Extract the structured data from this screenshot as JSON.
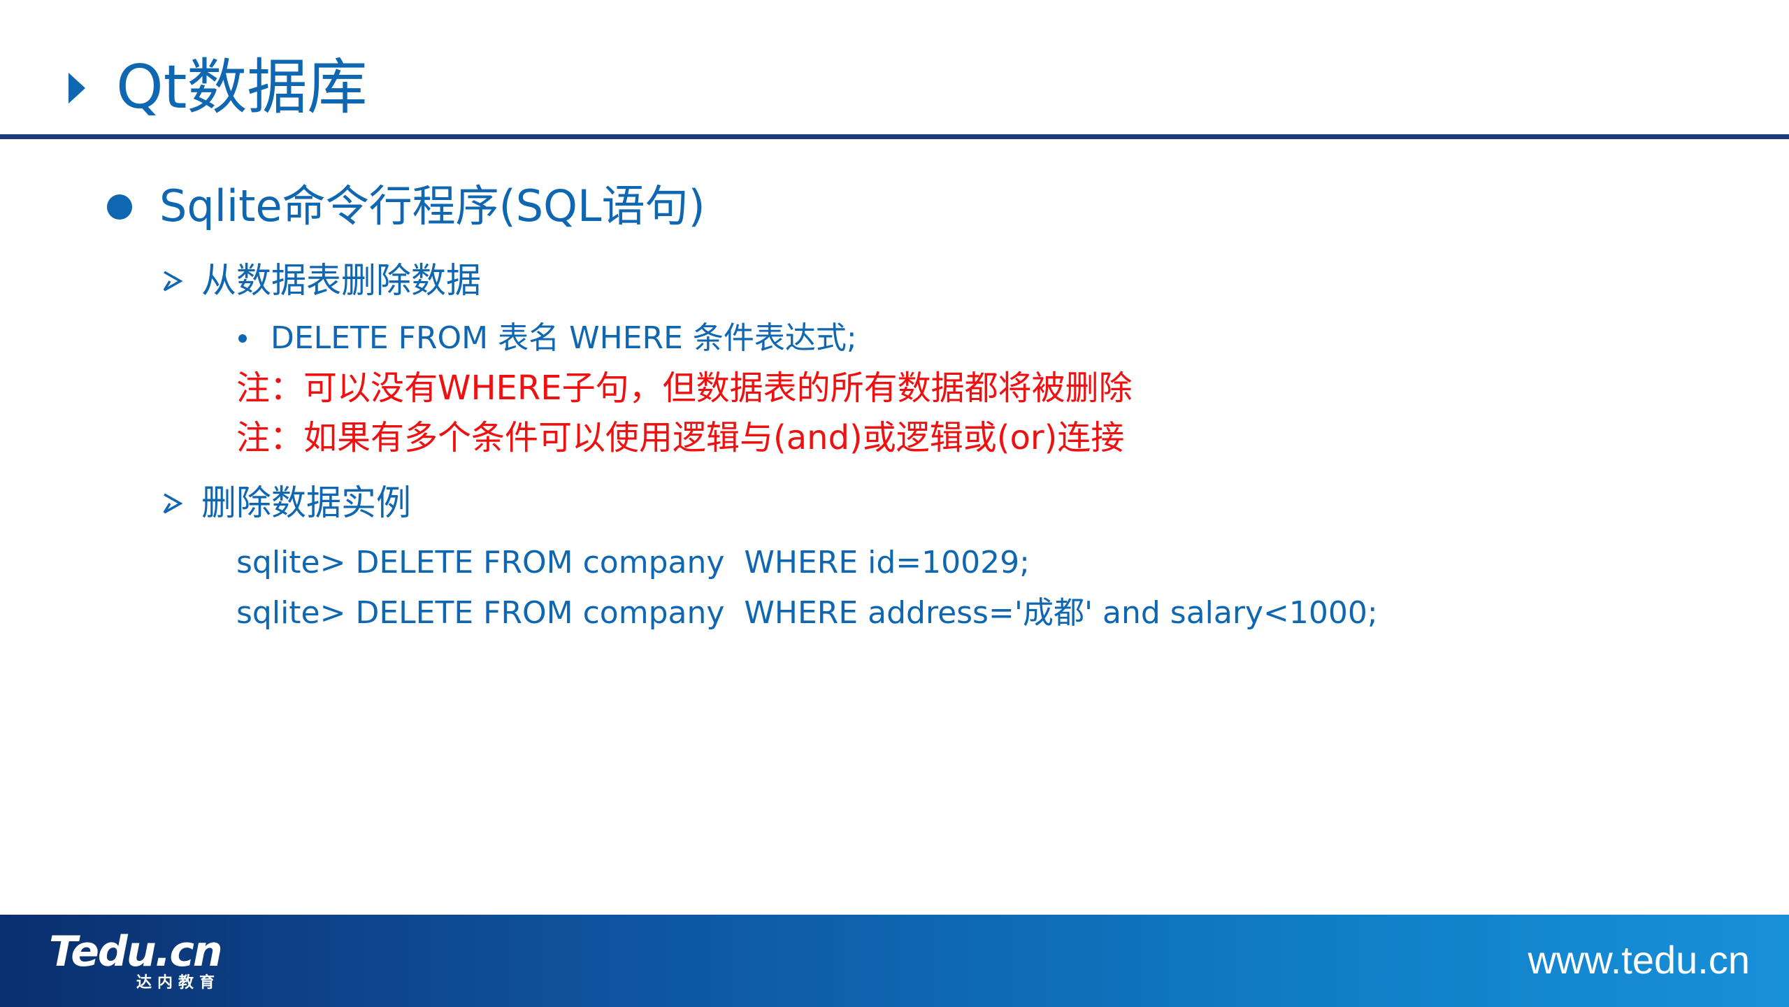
{
  "header": {
    "title": "Qt数据库"
  },
  "content": {
    "level1": "Sqlite命令行程序(SQL语句)",
    "section1": {
      "heading": "从数据表删除数据",
      "syntax": "DELETE FROM 表名 WHERE 条件表达式;",
      "notes": [
        "注：可以没有WHERE子句，但数据表的所有数据都将被删除",
        "注：如果有多个条件可以使用逻辑与(and)或逻辑或(or)连接"
      ]
    },
    "section2": {
      "heading": "删除数据实例",
      "examples": [
        "sqlite> DELETE FROM company  WHERE id=10029;",
        "sqlite> DELETE FROM company  WHERE address='成都' and salary<1000;"
      ]
    }
  },
  "footer": {
    "logo_text": "Tedu.cn",
    "logo_subtext": "达内教育",
    "url": "www.tedu.cn"
  },
  "colors": {
    "primary_blue": "#0f67b1",
    "rule_navy": "#1b3a78",
    "note_red": "#ee1111"
  }
}
